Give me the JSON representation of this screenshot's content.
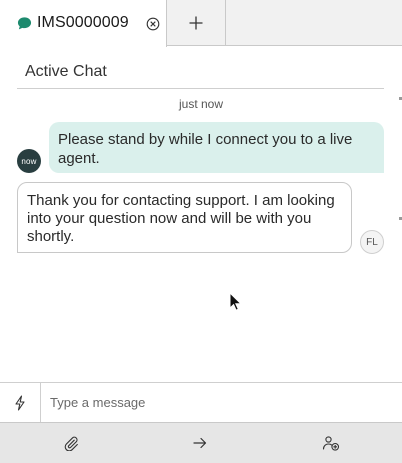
{
  "tab": {
    "label": "IMS0000009",
    "chat_icon": "chat-bubble-icon",
    "close_icon": "close-circle-icon",
    "add_icon": "plus-icon",
    "accent_color": "#1d8a6e"
  },
  "header": {
    "title": "Active Chat"
  },
  "conversation": {
    "timestamp": "just now",
    "messages": [
      {
        "author": "agent",
        "avatar_text": "now",
        "text": "Please stand by while I connect you to a live agent.",
        "bubble_color": "#daf0ec"
      },
      {
        "author": "user",
        "avatar_text": "FL",
        "text": "Thank you for contacting support. I am looking into your question now and will be with you shortly."
      }
    ]
  },
  "composer": {
    "quick_action_icon": "lightning-icon",
    "placeholder": "Type a message"
  },
  "toolbar": {
    "attach_icon": "paperclip-icon",
    "transfer_icon": "arrow-right-icon",
    "add_participant_icon": "add-person-icon"
  }
}
